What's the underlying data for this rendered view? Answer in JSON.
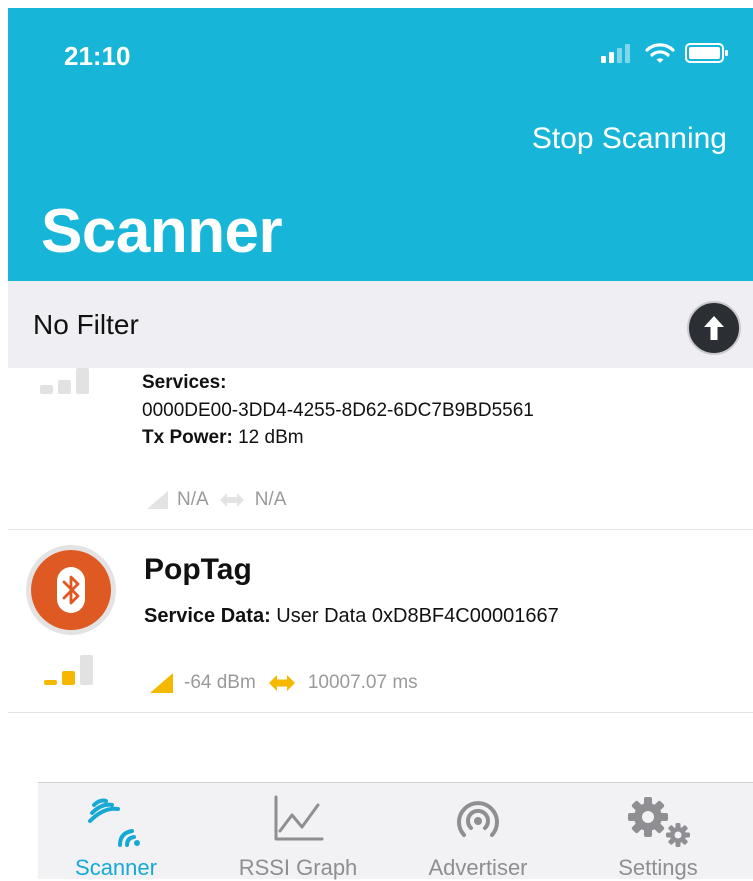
{
  "status_bar": {
    "time": "21:10"
  },
  "header": {
    "stop_button": "Stop Scanning",
    "title": "Scanner"
  },
  "filter": {
    "label": "No Filter"
  },
  "devices": [
    {
      "services_label": "Services:",
      "services_value": "0000DE00-3DD4-4255-8D62-6DC7B9BD5561",
      "tx_label": "Tx Power:",
      "tx_value": " 12 dBm",
      "rssi": "N/A",
      "interval": "N/A"
    },
    {
      "name": "PopTag",
      "service_data_label": "Service Data:",
      "service_data_value": " User Data 0xD8BF4C00001667",
      "rssi": "-64 dBm",
      "interval": "10007.07 ms",
      "accent_color": "#f5b800"
    }
  ],
  "tabs": [
    {
      "label": "Scanner",
      "icon": "scanner-icon",
      "active": true
    },
    {
      "label": "RSSI Graph",
      "icon": "graph-icon"
    },
    {
      "label": "Advertiser",
      "icon": "broadcast-icon"
    },
    {
      "label": "Settings",
      "icon": "gear-icon"
    }
  ],
  "colors": {
    "header": "#17b6d8",
    "active_tab": "#17a9d6",
    "avatar": "#df5a23"
  }
}
